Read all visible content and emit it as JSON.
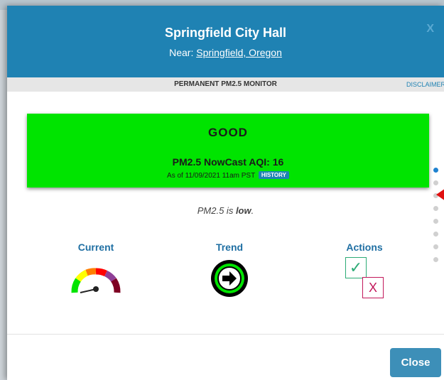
{
  "header": {
    "title": "Springfield City Hall",
    "near_prefix": "Near: ",
    "near_link": "Springfield, Oregon",
    "close_glyph": "X"
  },
  "monitor_bar": {
    "type": "PERMANENT PM2.5 MONITOR",
    "disclaimer": "DISCLAIMER"
  },
  "aqi": {
    "category": "GOOD",
    "value_label": "PM2.5 NowCast AQI: 16",
    "as_of": "As of 11/09/2021 11am PST",
    "history_badge": "HISTORY",
    "color": "#00e400"
  },
  "status": {
    "prefix": "PM2.5 is ",
    "level": "low",
    "suffix": "."
  },
  "indicators": [
    {
      "label": "Current",
      "icon": "aqi-gauge-icon"
    },
    {
      "label": "Trend",
      "icon": "arrow-right-circle-icon"
    },
    {
      "label": "Actions",
      "icon": "check-x-icon",
      "check_glyph": "✓",
      "x_glyph": "X"
    }
  ],
  "footer": {
    "close_label": "Close"
  },
  "pager": {
    "count": 8,
    "active_index": 0
  },
  "colors": {
    "header_bg": "#1f82b3",
    "good": "#00e400",
    "button": "#3d8fb8",
    "link": "#1f6fa3"
  }
}
